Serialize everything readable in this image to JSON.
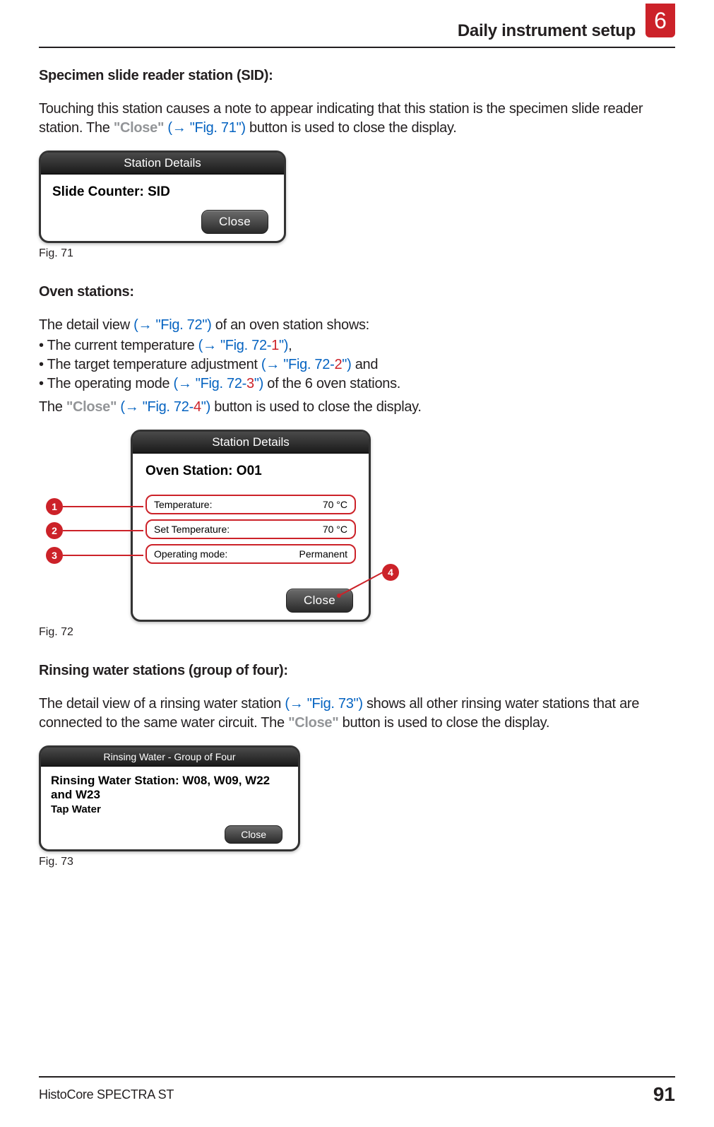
{
  "header": {
    "title": "Daily instrument setup",
    "chapter": "6"
  },
  "section1": {
    "title": "Specimen slide reader station (SID):",
    "para_lead": "Touching this station causes a note to appear indicating that this station is the specimen slide reader station. The ",
    "close_label": "\"Close\"",
    "xref_open": " (",
    "xref_arrow": "→ ",
    "xref_fig": "\"Fig. 71\"",
    "xref_close": ") ",
    "para_tail": "button is used to close the display."
  },
  "fig71": {
    "titlebar": "Station Details",
    "heading": "Slide Counter: SID",
    "close": "Close",
    "caption": "Fig. 71"
  },
  "section2": {
    "title": "Oven stations:",
    "intro_lead": "The detail view ",
    "intro_xref": "(→ \"Fig. 72\")",
    "intro_tail": " of an oven station shows:",
    "bullets": [
      {
        "lead": "The current temperature ",
        "xref": "(→ \"Fig. 72-",
        "num": "1",
        "xref2": "\")",
        "tail": ","
      },
      {
        "lead": "The target temperature adjustment ",
        "xref": "(→ \"Fig. 72-",
        "num": "2",
        "xref2": "\")",
        "tail": " and"
      },
      {
        "lead": "The operating mode ",
        "xref": "(→ \"Fig. 72-",
        "num": "3",
        "xref2": "\")",
        "tail": " of the 6 oven stations."
      }
    ],
    "closing_lead": "The ",
    "closing_bold": "\"Close\"",
    "closing_xref": " (→ \"Fig. 72-",
    "closing_num": "4",
    "closing_xref2": "\") ",
    "closing_tail": "button is used to close the display."
  },
  "fig72": {
    "titlebar": "Station Details",
    "heading": "Oven Station: O01",
    "rows": [
      {
        "label": "Temperature:",
        "value": "70 °C"
      },
      {
        "label": "Set Temperature:",
        "value": "70 °C"
      },
      {
        "label": "Operating mode:",
        "value": "Permanent"
      }
    ],
    "close": "Close",
    "callouts": [
      "1",
      "2",
      "3",
      "4"
    ],
    "caption": "Fig. 72"
  },
  "section3": {
    "title": "Rinsing water stations (group of four):",
    "para_lead": "The detail view of a rinsing water station ",
    "xref": "(→ \"Fig. 73\")",
    "para_mid": " shows all other rinsing water stations that are connected to the same water circuit. The ",
    "close_bold": "\"Close\"",
    "para_tail": " button is used to close the display."
  },
  "fig73": {
    "titlebar": "Rinsing Water - Group of Four",
    "line1": "Rinsing Water Station: W08, W09, W22 and W23",
    "line2": "Tap Water",
    "close": "Close",
    "caption": "Fig. 73"
  },
  "footer": {
    "product": "HistoCore SPECTRA ST",
    "page": "91"
  }
}
